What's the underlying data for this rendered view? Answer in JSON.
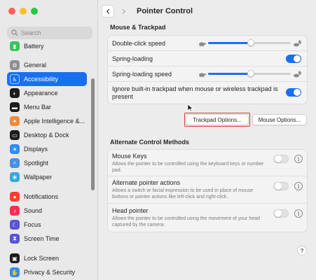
{
  "window": {
    "title": "Pointer Control"
  },
  "sidebar": {
    "search_placeholder": "Search",
    "items": [
      {
        "label": "Battery",
        "icon": "battery-icon",
        "color": "#35c759",
        "glyph": "▮"
      },
      {
        "label": "General",
        "icon": "gear-icon",
        "color": "#8e8e93",
        "glyph": "⚙"
      },
      {
        "label": "Accessibility",
        "icon": "accessibility-icon",
        "color": "#1a6ff0",
        "glyph": "♿",
        "active": true
      },
      {
        "label": "Appearance",
        "icon": "appearance-icon",
        "color": "#1c1c1e",
        "glyph": "◐"
      },
      {
        "label": "Menu Bar",
        "icon": "menu-bar-icon",
        "color": "#1c1c1e",
        "glyph": "▬"
      },
      {
        "label": "Apple Intelligence &...",
        "icon": "apple-intelligence-icon",
        "color": "#f08a3b",
        "glyph": "✦"
      },
      {
        "label": "Desktop & Dock",
        "icon": "desktop-dock-icon",
        "color": "#1c1c1e",
        "glyph": "▭"
      },
      {
        "label": "Displays",
        "icon": "displays-icon",
        "color": "#2f8cf6",
        "glyph": "☀"
      },
      {
        "label": "Spotlight",
        "icon": "spotlight-icon",
        "color": "#4a90e2",
        "glyph": "⌕"
      },
      {
        "label": "Wallpaper",
        "icon": "wallpaper-icon",
        "color": "#34aadc",
        "glyph": "❀"
      },
      {
        "label": "Notifications",
        "icon": "notifications-icon",
        "color": "#ff3b30",
        "glyph": "●"
      },
      {
        "label": "Sound",
        "icon": "sound-icon",
        "color": "#ff2d55",
        "glyph": "♪"
      },
      {
        "label": "Focus",
        "icon": "focus-icon",
        "color": "#5856d6",
        "glyph": "☾"
      },
      {
        "label": "Screen Time",
        "icon": "screen-time-icon",
        "color": "#5856d6",
        "glyph": "⧗"
      },
      {
        "label": "Lock Screen",
        "icon": "lock-screen-icon",
        "color": "#1c1c1e",
        "glyph": "▣"
      },
      {
        "label": "Privacy & Security",
        "icon": "privacy-icon",
        "color": "#2f8cf6",
        "glyph": "✋"
      }
    ]
  },
  "mouse_trackpad": {
    "heading": "Mouse & Trackpad",
    "double_click_label": "Double-click speed",
    "double_click_value": 0.52,
    "spring_loading_label": "Spring-loading",
    "spring_loading_on": true,
    "spring_loading_speed_label": "Spring-loading speed",
    "spring_loading_speed_value": 0.52,
    "ignore_trackpad_label": "Ignore built-in trackpad when mouse or wireless trackpad is present",
    "ignore_trackpad_on": true,
    "trackpad_options_label": "Trackpad Options...",
    "mouse_options_label": "Mouse Options..."
  },
  "alternate": {
    "heading": "Alternate Control Methods",
    "mouse_keys_label": "Mouse Keys",
    "mouse_keys_desc": "Allows the pointer to be controlled using the keyboard keys or number pad.",
    "alt_pointer_label": "Alternate pointer actions",
    "alt_pointer_desc": "Allows a switch or facial expression to be used in place of mouse buttons or pointer actions like left-click and right-click.",
    "head_pointer_label": "Head pointer",
    "head_pointer_desc": "Allows the pointer to be controlled using the movement of your head captured by the camera."
  },
  "help_label": "?",
  "info_label": "i",
  "colors": {
    "accent": "#1a6ff0",
    "highlight": "#e0382f"
  }
}
